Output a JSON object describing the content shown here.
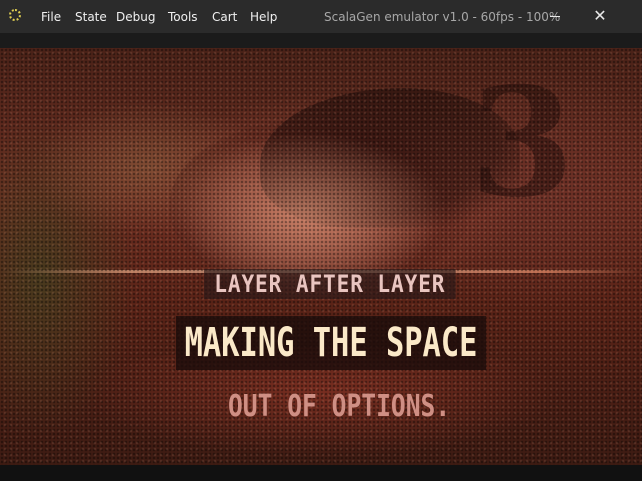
{
  "menu": {
    "items": [
      "File",
      "State",
      "Debug",
      "Tools",
      "Cart",
      "Help"
    ]
  },
  "window": {
    "title": "ScalaGen emulator v1.0 - 60fps - 100%",
    "minimize_glyph": "—",
    "close_glyph": "✕"
  },
  "icons": {
    "app": "app-logo-icon",
    "minimize": "minimize-icon",
    "close": "close-icon"
  },
  "game": {
    "line1": "LAYER AFTER LAYER",
    "line2": "MAKING THE SPACE",
    "line3": "OUT OF OPTIONS."
  },
  "colors": {
    "titlebar": "#2b2b2b",
    "app_icon": "#e0cf52",
    "line1_text": "#e9c5c0",
    "line2_text": "#fbe9c8",
    "line3_text": "#cf8f84"
  }
}
